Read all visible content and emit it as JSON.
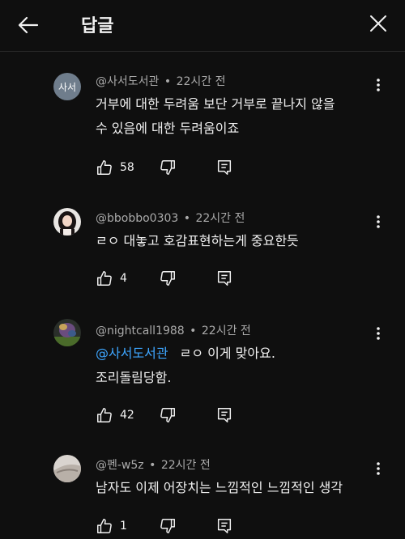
{
  "header": {
    "title": "답글"
  },
  "comments": [
    {
      "handle": "@사서도서관",
      "separator": "•",
      "time": "22시간 전",
      "avatar_text": "사서",
      "lines": [
        "거부에 대한 두려움 보단 거부로 끝나지 않을",
        "수 있음에 대한 두려움이죠"
      ],
      "likes": "58"
    },
    {
      "handle": "@bbobbo0303",
      "separator": "•",
      "time": "22시간 전",
      "lines": [
        "ㄹㅇ 대놓고 호감표현하는게 중요한듯"
      ],
      "likes": "4"
    },
    {
      "handle": "@nightcall1988",
      "separator": "•",
      "time": "22시간 전",
      "mention": "@사서도서관",
      "lines": [
        "ㄹㅇ 이게 맞아요.",
        "조리돌림당함."
      ],
      "likes": "42"
    },
    {
      "handle": "@펜-w5z",
      "separator": "•",
      "time": "22시간 전",
      "lines": [
        "남자도 이제 어장치는 느낌적인 느낌적인 생각"
      ],
      "likes": "1"
    }
  ]
}
